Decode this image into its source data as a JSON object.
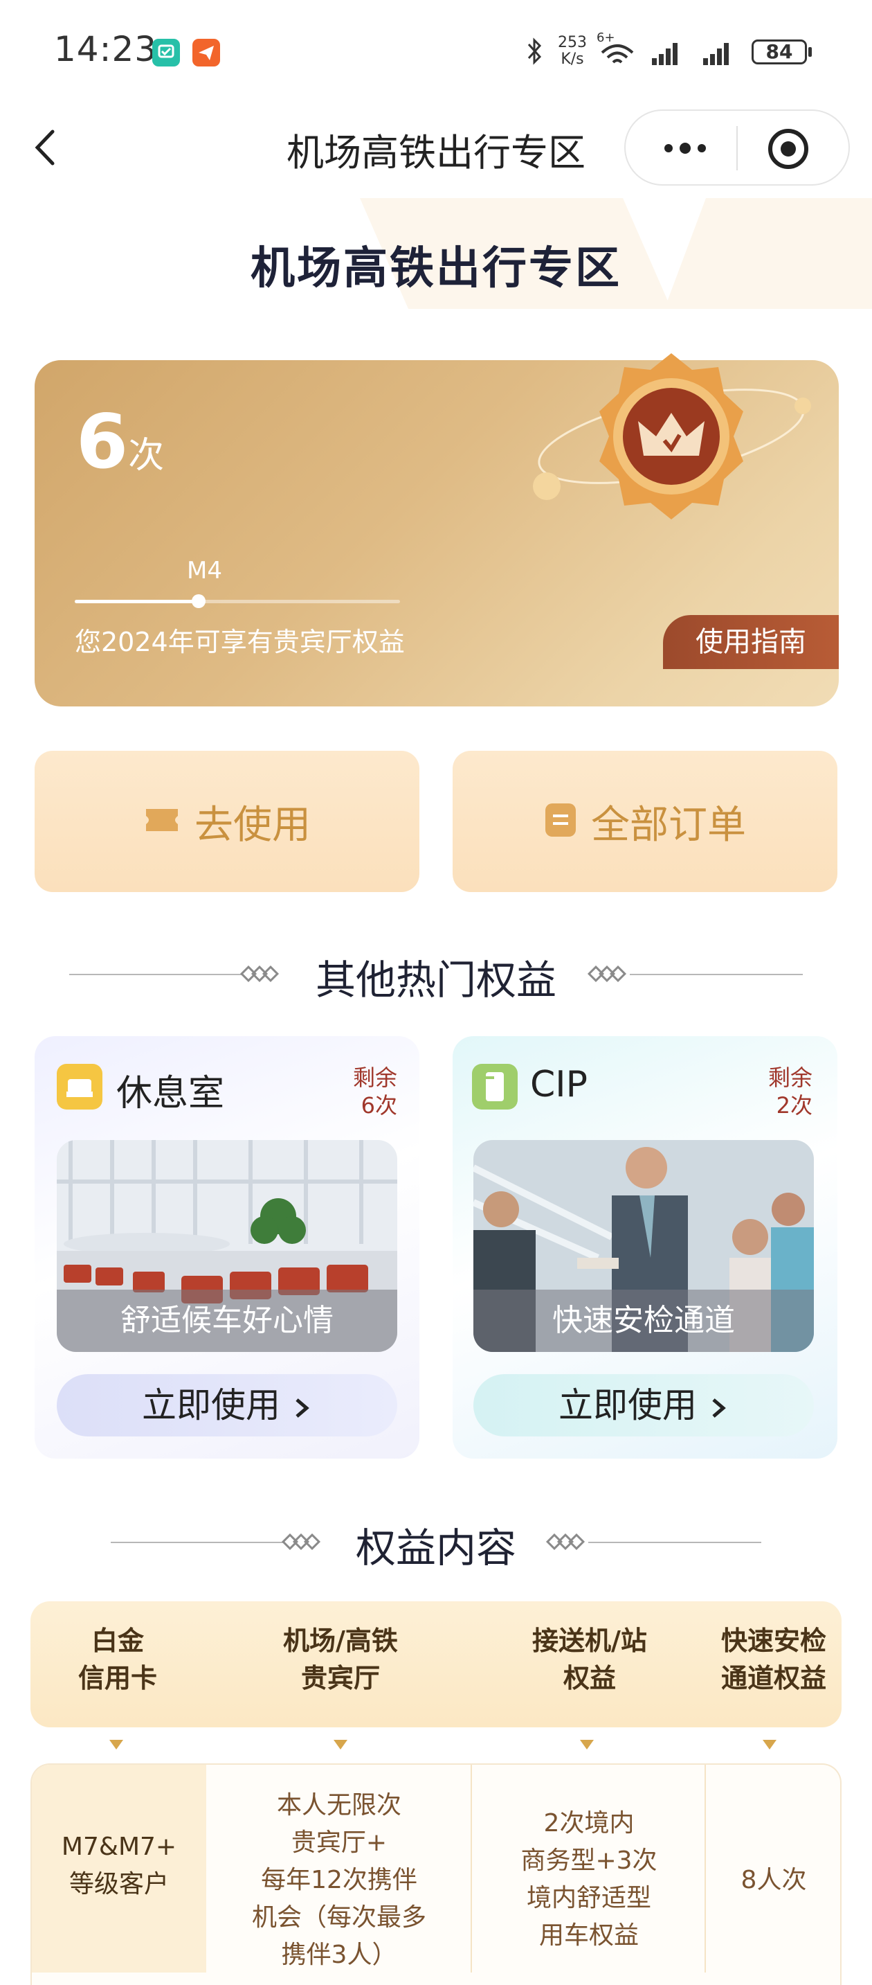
{
  "status_bar": {
    "time": "14:23",
    "net_speed_value": "253",
    "net_speed_unit": "K/s",
    "wifi_tag": "6+",
    "battery": "84"
  },
  "nav": {
    "title": "机场高铁出行专区"
  },
  "page": {
    "heading": "机场高铁出行专区"
  },
  "card": {
    "count": "6",
    "count_unit": "次",
    "level": "M4",
    "level_progress": 0.38,
    "subtitle": "您2024年可享有贵宾厅权益",
    "guide_label": "使用指南"
  },
  "actions": [
    {
      "label": "去使用"
    },
    {
      "label": "全部订单"
    }
  ],
  "other_section": {
    "title": "其他热门权益"
  },
  "benefits": [
    {
      "title": "休息室",
      "remain_line1": "剩余",
      "remain_line2": "6次",
      "caption": "舒适候车好心情",
      "button": "立即使用"
    },
    {
      "title": "CIP",
      "remain_line1": "剩余",
      "remain_line2": "2次",
      "caption": "快速安检通道",
      "button": "立即使用"
    }
  ],
  "content_section": {
    "title": "权益内容"
  },
  "table": {
    "headers": [
      {
        "line1": "白金",
        "line2": "信用卡"
      },
      {
        "line1": "机场/高铁",
        "line2": "贵宾厅"
      },
      {
        "line1": "接送机/站",
        "line2": "权益"
      },
      {
        "line1": "快速安检",
        "line2": "通道权益"
      }
    ],
    "row": {
      "c0_line1": "M7&M7+",
      "c0_line2": "等级客户",
      "c1": [
        "本人无限次",
        "贵宾厅+",
        "每年12次携伴",
        "机会（每次最多",
        "携伴3人）"
      ],
      "c2": [
        "2次境内",
        "商务型+3次",
        "境内舒适型",
        "用车权益"
      ],
      "c3": "8人次"
    }
  },
  "colors": {
    "gold_text": "#c9913f",
    "remain_red": "#a0372b",
    "guide_bg": "#9c4a2c",
    "table_text": "#7a5330"
  }
}
